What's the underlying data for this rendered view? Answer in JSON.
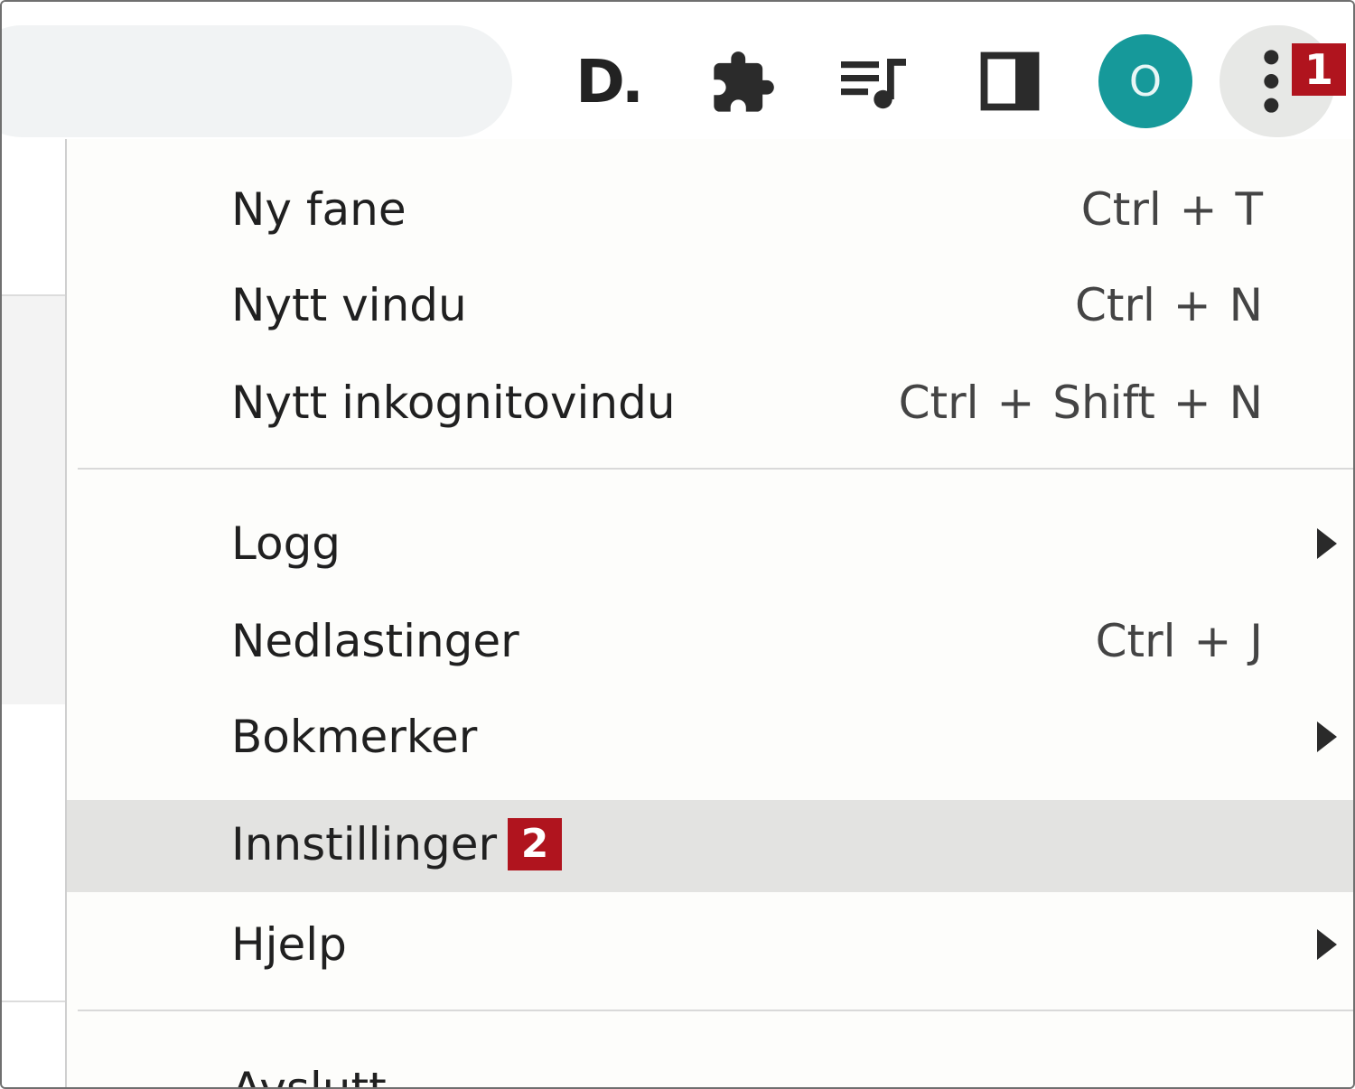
{
  "toolbar": {
    "logo_text": "D.",
    "icons": [
      "extensions-icon",
      "media-control-icon",
      "side-panel-icon"
    ],
    "avatar_letter": "O",
    "avatar_color": "#16999a",
    "menu_badge": "1"
  },
  "menu": {
    "items": [
      {
        "label": "Ny fane",
        "shortcut": "Ctrl + T"
      },
      {
        "label": "Nytt vindu",
        "shortcut": "Ctrl + N"
      },
      {
        "label": "Nytt inkognitovindu",
        "shortcut": "Ctrl + Shift + N"
      },
      {
        "label": "Logg",
        "has_submenu": true
      },
      {
        "label": "Nedlastinger",
        "shortcut": "Ctrl + J"
      },
      {
        "label": "Bokmerker",
        "has_submenu": true
      },
      {
        "label": "Innstillinger",
        "badge": "2",
        "highlighted": true
      },
      {
        "label": "Hjelp",
        "has_submenu": true
      },
      {
        "label": "Avslutt"
      }
    ]
  },
  "colors": {
    "badge": "#b0141e",
    "highlight": "#e3e3e1"
  }
}
